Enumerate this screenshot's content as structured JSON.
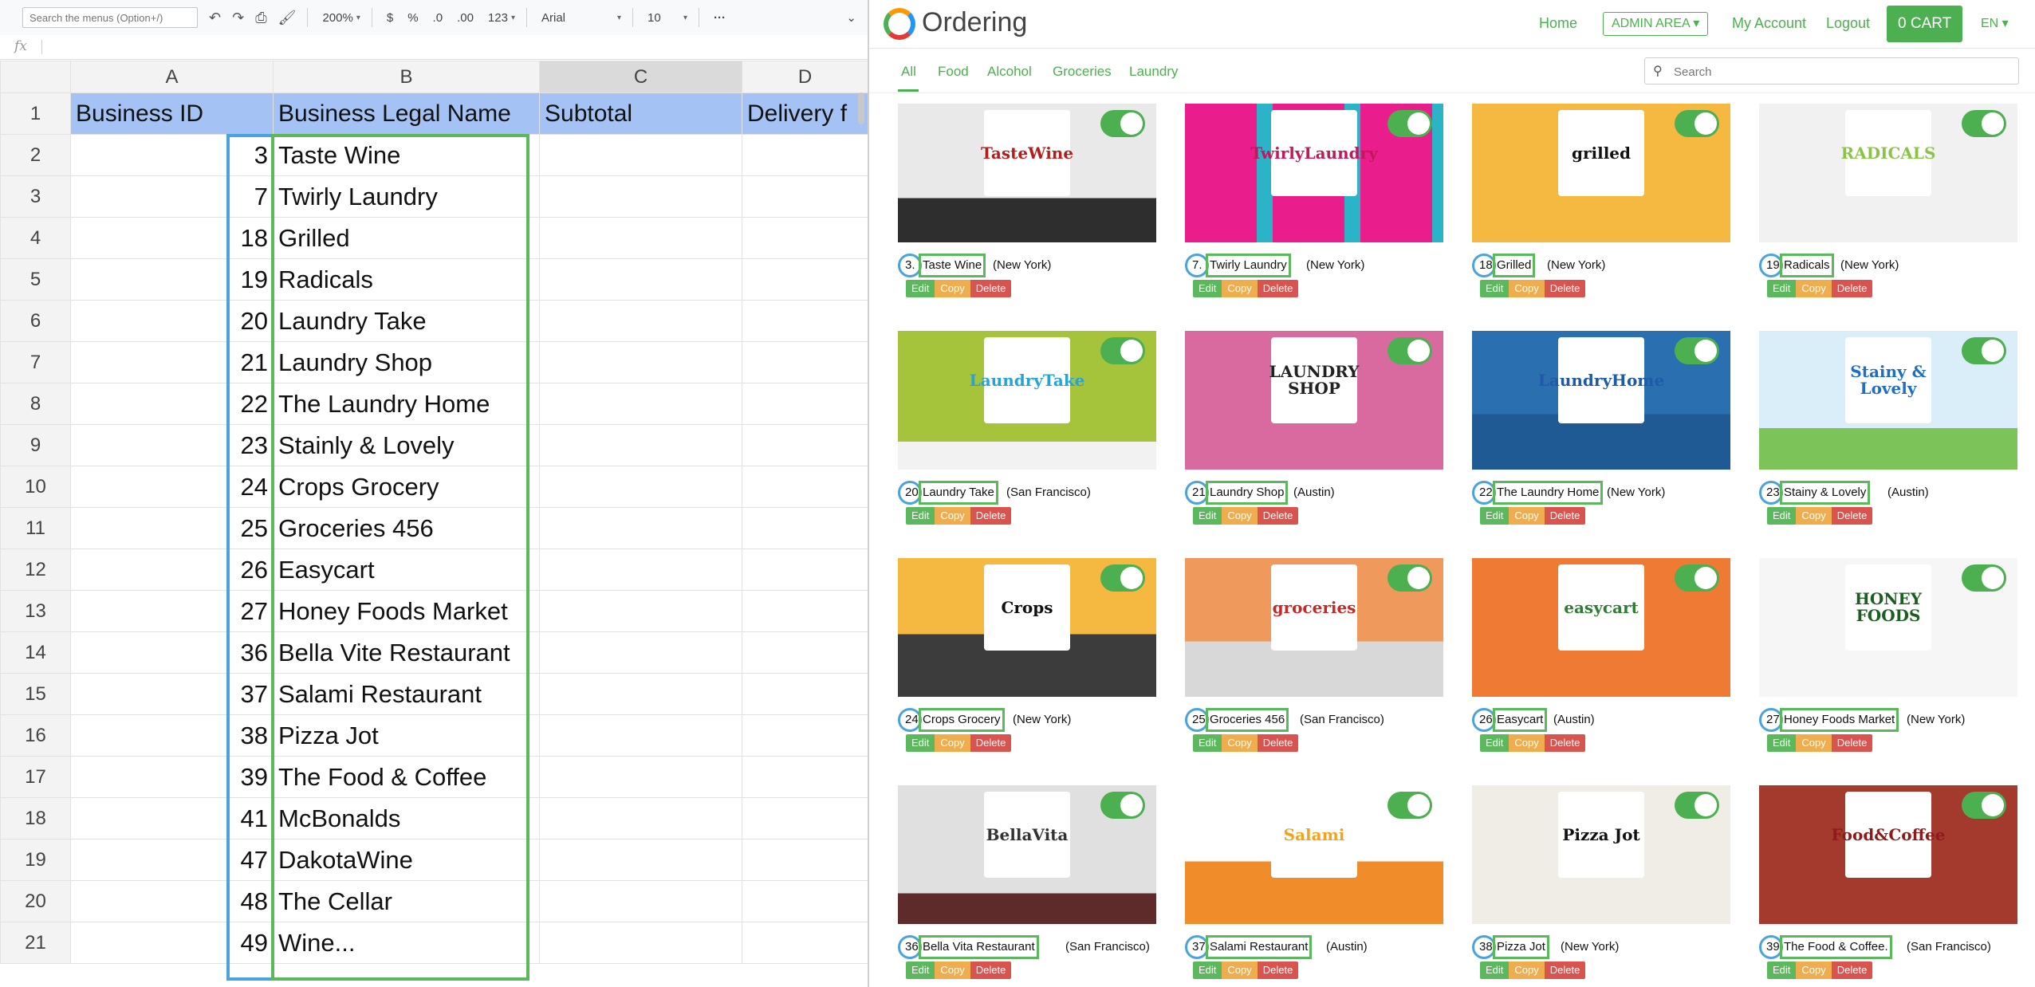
{
  "sheet": {
    "toolbar": {
      "menu_search_placeholder": "Search the menus (Option+/)",
      "zoom": "200%",
      "currency": "$",
      "percent": "%",
      "dec_decrease": ".0",
      "dec_increase": ".00",
      "number_format": "123",
      "font": "Arial",
      "font_size": "10",
      "more": "···",
      "collapse": "⌄"
    },
    "fx_label": "fx",
    "columns": [
      "A",
      "B",
      "C",
      "D"
    ],
    "header_row": {
      "num": "1",
      "a": "Business ID",
      "b": "Business Legal Name",
      "c": "Subtotal",
      "d": "Delivery f"
    },
    "rows": [
      {
        "num": "2",
        "id": "3",
        "name": "Taste Wine"
      },
      {
        "num": "3",
        "id": "7",
        "name": "Twirly Laundry"
      },
      {
        "num": "4",
        "id": "18",
        "name": "Grilled"
      },
      {
        "num": "5",
        "id": "19",
        "name": "Radicals"
      },
      {
        "num": "6",
        "id": "20",
        "name": "Laundry Take"
      },
      {
        "num": "7",
        "id": "21",
        "name": "Laundry Shop"
      },
      {
        "num": "8",
        "id": "22",
        "name": "The Laundry Home"
      },
      {
        "num": "9",
        "id": "23",
        "name": "Stainly & Lovely"
      },
      {
        "num": "10",
        "id": "24",
        "name": "Crops Grocery"
      },
      {
        "num": "11",
        "id": "25",
        "name": "Groceries 456"
      },
      {
        "num": "12",
        "id": "26",
        "name": "Easycart"
      },
      {
        "num": "13",
        "id": "27",
        "name": "Honey Foods Market"
      },
      {
        "num": "14",
        "id": "36",
        "name": "Bella Vite Restaurant"
      },
      {
        "num": "15",
        "id": "37",
        "name": "Salami Restaurant"
      },
      {
        "num": "16",
        "id": "38",
        "name": "Pizza Jot"
      },
      {
        "num": "17",
        "id": "39",
        "name": "The Food & Coffee"
      },
      {
        "num": "18",
        "id": "41",
        "name": "McBonalds"
      },
      {
        "num": "19",
        "id": "47",
        "name": "DakotaWine"
      },
      {
        "num": "20",
        "id": "48",
        "name": "The Cellar"
      },
      {
        "num": "21",
        "id": "49",
        "name": "Wine..."
      }
    ]
  },
  "app": {
    "brand": "Ordering",
    "nav": {
      "home": "Home",
      "admin": "ADMIN AREA ▾",
      "account": "My Account",
      "logout": "Logout",
      "cart": "0 CART",
      "lang": "EN ▾"
    },
    "categories": [
      "All",
      "Food",
      "Alcohol",
      "Groceries",
      "Laundry"
    ],
    "search_placeholder": "Search",
    "actions": {
      "edit": "Edit",
      "copy": "Copy",
      "delete": "Delete"
    },
    "businesses": [
      {
        "id": "3",
        "name": "Taste Wine",
        "city": "(New York)",
        "logo": "TasteWine",
        "logo_color": "#b71c1c",
        "bg": "bg-wine"
      },
      {
        "id": "7",
        "name": "Twirly Laundry",
        "city": "(New York)",
        "logo": "TwirlyLaundry",
        "logo_color": "#c2185b",
        "bg": "bg-laundry1"
      },
      {
        "id": "18",
        "name": "Grilled",
        "city": "(New York)",
        "logo": "grilled",
        "logo_color": "#111111",
        "bg": "bg-grilled"
      },
      {
        "id": "19",
        "name": "Radicals",
        "city": "(New York)",
        "logo": "RADICALS",
        "logo_color": "#8bc34a",
        "bg": "bg-radicals"
      },
      {
        "id": "20",
        "name": "Laundry Take",
        "city": "(San Francisco)",
        "logo": "LaundryTake",
        "logo_color": "#29a3d6",
        "bg": "bg-laundry2"
      },
      {
        "id": "21",
        "name": "Laundry Shop",
        "city": "(Austin)",
        "logo": "LAUNDRY SHOP",
        "logo_color": "#222222",
        "bg": "bg-shop"
      },
      {
        "id": "22",
        "name": "The Laundry Home",
        "city": "(New York)",
        "logo": "LaundryHome",
        "logo_color": "#1e5aa8",
        "bg": "bg-home"
      },
      {
        "id": "23",
        "name": "Stainy & Lovely",
        "city": "(Austin)",
        "logo": "Stainy & Lovely",
        "logo_color": "#1e6fc1",
        "bg": "bg-stainy"
      },
      {
        "id": "24",
        "name": "Crops Grocery",
        "city": "(New York)",
        "logo": "Crops",
        "logo_color": "#111111",
        "bg": "bg-crops"
      },
      {
        "id": "25",
        "name": "Groceries 456",
        "city": "(San Francisco)",
        "logo": "groceries",
        "logo_color": "#c62828",
        "bg": "bg-groceries"
      },
      {
        "id": "26",
        "name": "Easycart",
        "city": "(Austin)",
        "logo": "easycart",
        "logo_color": "#2e7d32",
        "bg": "bg-easycart"
      },
      {
        "id": "27",
        "name": "Honey Foods Market",
        "city": "(New York)",
        "logo": "HONEY FOODS",
        "logo_color": "#1b5e20",
        "bg": "bg-honey"
      },
      {
        "id": "36",
        "name": "Bella Vita Restaurant",
        "city": "(San Francisco)",
        "logo": "BellaVita",
        "logo_color": "#333333",
        "bg": "bg-bella"
      },
      {
        "id": "37",
        "name": "Salami Restaurant",
        "city": "(Austin)",
        "logo": "Salami",
        "logo_color": "#f2a31b",
        "bg": "bg-salami"
      },
      {
        "id": "38",
        "name": "Pizza Jot",
        "city": "(New York)",
        "logo": "Pizza Jot",
        "logo_color": "#111111",
        "bg": "bg-pizza"
      },
      {
        "id": "39",
        "name": "The Food & Coffee.",
        "city": "(San Francisco)",
        "logo": "Food&Coffee",
        "logo_color": "#8e1b1b",
        "bg": "bg-coffee"
      }
    ]
  }
}
